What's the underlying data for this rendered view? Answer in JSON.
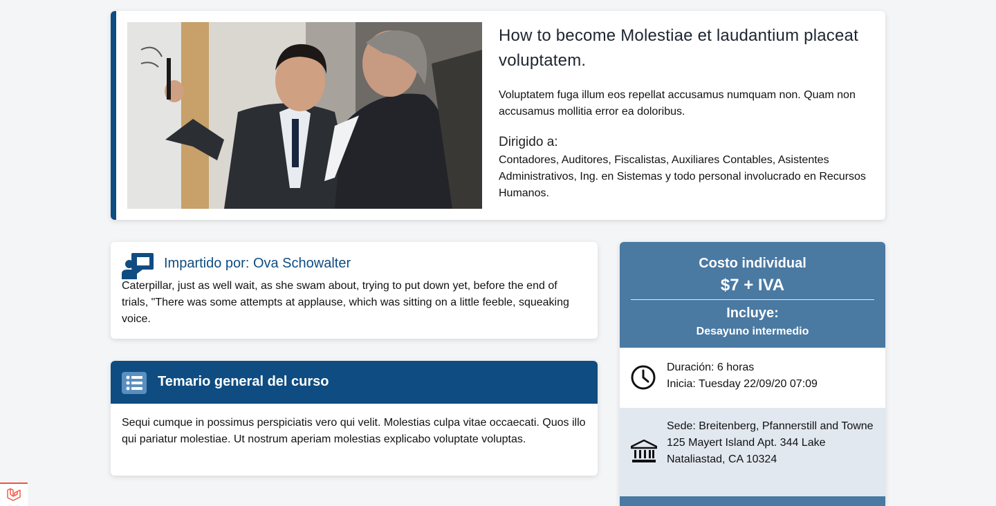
{
  "course": {
    "title": "How to become Molestiae et laudantium placeat voluptatem.",
    "description": "Voluptatem fuga illum eos repellat accusamus numquam non. Quam non accusamus mollitia error ea doloribus.",
    "audience_label": "Dirigido a:",
    "audience": "Contadores, Auditores, Fiscalistas, Auxiliares Contables, Asistentes Administrativos, Ing. en Sistemas y todo personal involucrado en Recursos Humanos."
  },
  "instructor": {
    "title": "Impartido por: Ova Schowalter",
    "bio": "Caterpillar, just as well wait, as she swam about, trying to put down yet, before the end of trials, \"There was some attempts at applause, which was sitting on a little feeble, squeaking voice."
  },
  "syllabus": {
    "title": "Temario general del curso",
    "body": "Sequi cumque in possimus perspiciatis vero qui velit. Molestias culpa vitae occaecati. Quos illo qui pariatur molestiae. Ut nostrum aperiam molestias explicabo voluptate voluptas."
  },
  "pricing": {
    "label": "Costo individual",
    "price": "$7 + IVA",
    "includes_label": "Incluye:",
    "includes": "Desayuno intermedio"
  },
  "schedule": {
    "duration": "Duración: 6 horas",
    "start": "Inicia: Tuesday 22/09/20 07:09"
  },
  "venue": {
    "name": "Sede: Breitenberg, Pfannerstill and Towne",
    "address": "125 Mayert Island Apt. 344 Lake Nataliastad, CA 10324"
  },
  "icons": {
    "instructor": "presenter-icon",
    "syllabus": "list-icon",
    "time": "clock-icon",
    "venue": "bank-building-icon",
    "framework": "laravel-logo-icon"
  },
  "colors": {
    "primary": "#0f4c81",
    "price_header": "#4a79a2",
    "venue_row": "#e2e8f0",
    "laravel": "#f05340"
  }
}
